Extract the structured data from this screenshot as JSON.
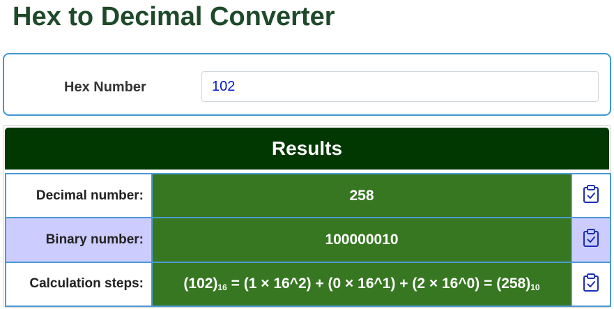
{
  "page": {
    "title": "Hex to Decimal Converter"
  },
  "input": {
    "label": "Hex Number",
    "value": "102"
  },
  "results": {
    "header": "Results",
    "rows": [
      {
        "label": "Decimal number:",
        "value": "258"
      },
      {
        "label": "Binary number:",
        "value": "100000010"
      },
      {
        "label": "Calculation steps:",
        "value_prefix": "(102)",
        "value_prefix_base": "16",
        "value_main": " = (1 × 16^2) + (0 × 16^1) + (2 × 16^0) = (258)",
        "value_suffix_base": "10"
      }
    ]
  },
  "icons": {
    "copy": "clipboard-check-icon"
  },
  "colors": {
    "title": "#1e4a2a",
    "panel_border": "#3d97d3",
    "input_text": "#0019c8",
    "results_header_bg": "#013700",
    "value_cell_bg": "#377721",
    "alt_row_bg": "#ccccff",
    "table_border": "#4a9ad4",
    "icon_stroke": "#1a2fb5"
  }
}
